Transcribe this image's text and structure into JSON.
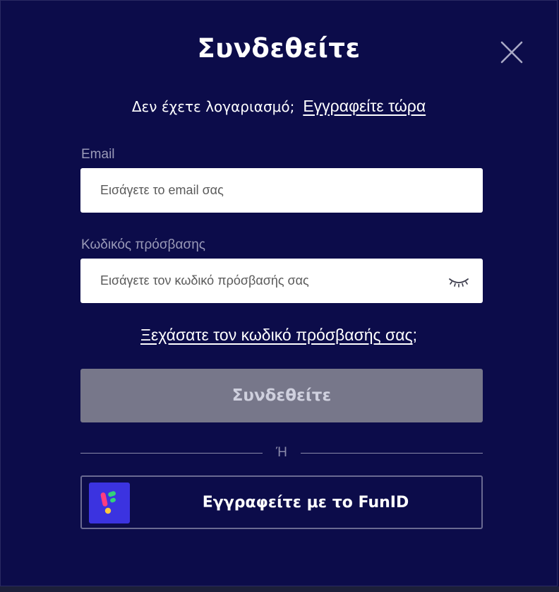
{
  "modal": {
    "title": "Συνδεθείτε",
    "signup_prompt": "Δεν έχετε λογαριασμό;",
    "signup_link": "Εγγραφείτε τώρα"
  },
  "form": {
    "email_label": "Email",
    "email_placeholder": "Εισάγετε το email σας",
    "email_value": "",
    "password_label": "Κωδικός πρόσβασης",
    "password_placeholder": "Εισάγετε τον κωδικό πρόσβασής σας",
    "password_value": "",
    "password_toggle_icon": "eye-closed-icon",
    "forgot_link": "Ξεχάσατε τον κωδικό πρόσβασής σας",
    "forgot_suffix": ";",
    "submit_label": "Συνδεθείτε",
    "submit_enabled": false
  },
  "divider": {
    "text": "Ή"
  },
  "funid": {
    "label": "Εγγραφείτε με το FunID",
    "logo_icon": "funid-logo-icon"
  },
  "colors": {
    "background": "#0c0c4a",
    "submit_disabled": "#77778a",
    "funid_brand": "#3b33e0",
    "funid_green": "#33d17a",
    "funid_pink": "#ff3d7f",
    "funid_yellow": "#ffc83d"
  },
  "icons": {
    "close": "close-icon"
  }
}
